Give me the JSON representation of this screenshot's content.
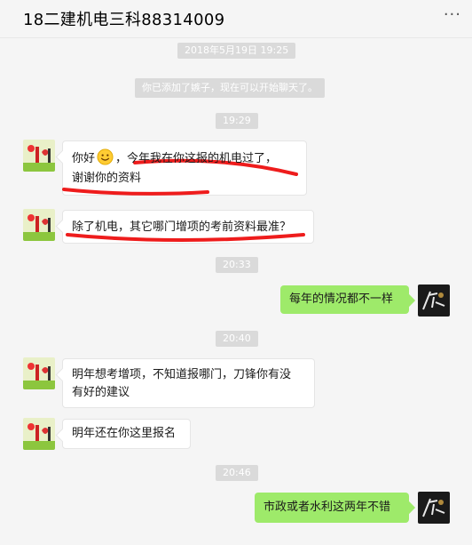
{
  "header": {
    "title": "18二建机电三科88314009",
    "more_label": "···"
  },
  "timestamps": [
    "2018年5月19日 19:25",
    "19:29",
    "20:33",
    "20:40",
    "20:46"
  ],
  "system_notice": "你已添加了嫉子，现在可以开始聊天了。",
  "messages": [
    {
      "side": "left",
      "line1_before": "你好",
      "line1_after": "，今年我在你这报的机电过了，",
      "line2": "谢谢你的资料",
      "emoji": "smile-emoji"
    },
    {
      "side": "left",
      "text": "除了机电，其它哪门增项的考前资料最准？"
    },
    {
      "side": "right",
      "text": "每年的情况都不一样"
    },
    {
      "side": "left",
      "line1": "明年想考增项，不知道报哪门，刀锋你有没",
      "line2": "有好的建议"
    },
    {
      "side": "left",
      "text": "明年还在你这里报名"
    },
    {
      "side": "right",
      "text": "市政或者水利这两年不错"
    }
  ],
  "colors": {
    "bubble_self": "#9eea6a",
    "annotation": "#ee1c1c",
    "background": "#f5f5f5"
  }
}
